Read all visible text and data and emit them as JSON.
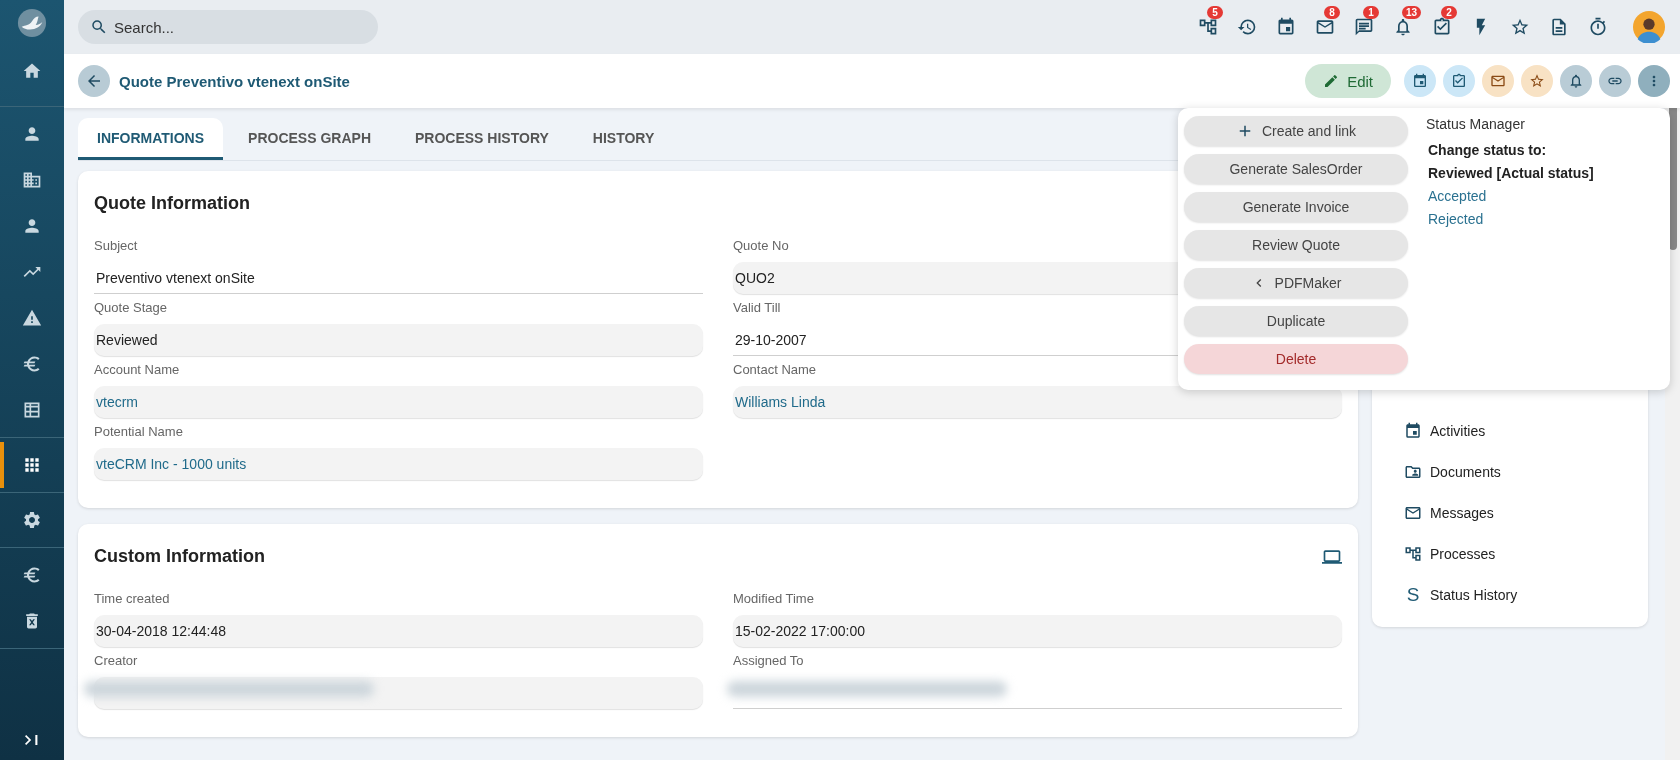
{
  "sidebar": {
    "items": [
      {
        "selected": false
      },
      {
        "selected": false
      },
      {
        "selected": false
      },
      {
        "selected": false
      },
      {
        "selected": false
      },
      {
        "selected": false
      },
      {
        "selected": false
      },
      {
        "selected": false
      },
      {
        "selected": true
      },
      {
        "selected": false
      },
      {
        "selected": false
      },
      {
        "selected": false
      }
    ]
  },
  "search": {
    "placeholder": "Search..."
  },
  "top_badges": [
    "5",
    "8",
    "1",
    "13",
    "2"
  ],
  "header": {
    "title": "Quote Preventivo vtenext onSite",
    "edit": "Edit"
  },
  "tabs": [
    {
      "label": "INFORMATIONS",
      "selected": true
    },
    {
      "label": "PROCESS GRAPH",
      "selected": false
    },
    {
      "label": "PROCESS HISTORY",
      "selected": false
    },
    {
      "label": "HISTORY",
      "selected": false
    }
  ],
  "sections": [
    {
      "title": "Quote Information",
      "fields": [
        {
          "label": "Subject",
          "value": "Preventivo vtenext onSite",
          "kind": "line",
          "link": false
        },
        {
          "label": "Quote No",
          "value": "QUO2",
          "kind": "box",
          "link": false
        },
        {
          "label": "Quote Stage",
          "value": "Reviewed",
          "kind": "box",
          "link": false
        },
        {
          "label": "Valid Till",
          "value": "29-10-2007",
          "kind": "line",
          "link": false
        },
        {
          "label": "Account Name",
          "value": "vtecrm",
          "kind": "box",
          "link": true
        },
        {
          "label": "Contact Name",
          "value": "Williams Linda",
          "kind": "box",
          "link": true
        },
        {
          "label": "Potential Name",
          "value": "vteCRM Inc - 1000 units",
          "kind": "box",
          "link": true
        }
      ]
    },
    {
      "title": "Custom Information",
      "fields": [
        {
          "label": "Time created",
          "value": "30-04-2018 12:44:48",
          "kind": "box",
          "link": false
        },
        {
          "label": "Modified Time",
          "value": "15-02-2022 17:00:00",
          "kind": "box",
          "link": false
        },
        {
          "label": "Creator",
          "kind": "box",
          "redacted": true
        },
        {
          "label": "Assigned To",
          "kind": "line",
          "redacted": true
        }
      ]
    }
  ],
  "related": [
    {
      "label": "Activities"
    },
    {
      "label": "Documents"
    },
    {
      "label": "Messages"
    },
    {
      "label": "Processes"
    },
    {
      "label": "Status History",
      "glyph": "S"
    }
  ],
  "menu": {
    "actions": [
      {
        "label": "Create and link",
        "kind": "plus"
      },
      {
        "label": "Generate SalesOrder",
        "kind": "plain"
      },
      {
        "label": "Generate Invoice",
        "kind": "plain"
      },
      {
        "label": "Review Quote",
        "kind": "plain"
      },
      {
        "label": "PDFMaker",
        "kind": "submenu"
      },
      {
        "label": "Duplicate",
        "kind": "plain"
      },
      {
        "label": "Delete",
        "kind": "danger"
      }
    ],
    "status_title": "Status Manager",
    "status_heading": "Change status to:",
    "current": "Reviewed [Actual status]",
    "options": [
      "Accepted",
      "Rejected"
    ]
  }
}
